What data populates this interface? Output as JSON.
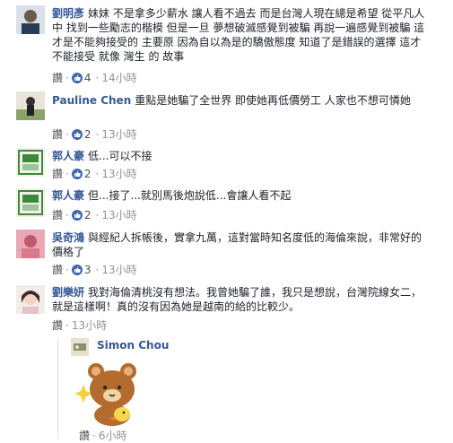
{
  "comments": [
    {
      "name": "劉明彥",
      "text": "妹妹 不是拿多少薪水 讓人看不過去 而是台灣人現在總是希望 從平凡人中 找到一些勵志的楷模 但是一旦 夢想破滅感覺到被騙 再說一遍感覺到被騙 這才是不能夠接受的 主要原 因為自以為是的驕傲態度 知道了是錯誤的選擇 這才不能接受 就像 灣生 的 故事",
      "like": "讚",
      "reactions": "4",
      "time": "14小時"
    },
    {
      "name": "Pauline Chen",
      "text": "重點是她騙了全世界 即使她再低價勞工 人家也不想可憐她",
      "like": "讚",
      "reactions": "2",
      "time": "13小時"
    },
    {
      "name": "郭人豪",
      "text": "低...可以不接",
      "like": "讚",
      "reactions": "2",
      "time": "13小時"
    },
    {
      "name": "郭人豪",
      "text": "但...接了...就別馬後炮說低...會讓人看不起",
      "like": "讚",
      "reactions": "2",
      "time": "13小時"
    },
    {
      "name": "吳奇鴻",
      "text": "與經紀人拆帳後，實拿九萬，這對當時知名度低的海倫來說，非常好的價格了",
      "like": "讚",
      "reactions": "3",
      "time": "13小時"
    },
    {
      "name": "劉樂妍",
      "text": "我對海倫清桃沒有想法。我曾她騙了誰，我只是想說，台灣院線女二，就是這樣啊！真的沒有因為她是越南的給的比較少。",
      "like": "讚",
      "reactions": "",
      "time": "13小時"
    }
  ],
  "reply": {
    "name": "Simon Chou",
    "like": "讚",
    "time": "6小時"
  },
  "colors": {
    "name": "#365899",
    "meta": "#90949c",
    "like_badge": "#4267b2"
  }
}
